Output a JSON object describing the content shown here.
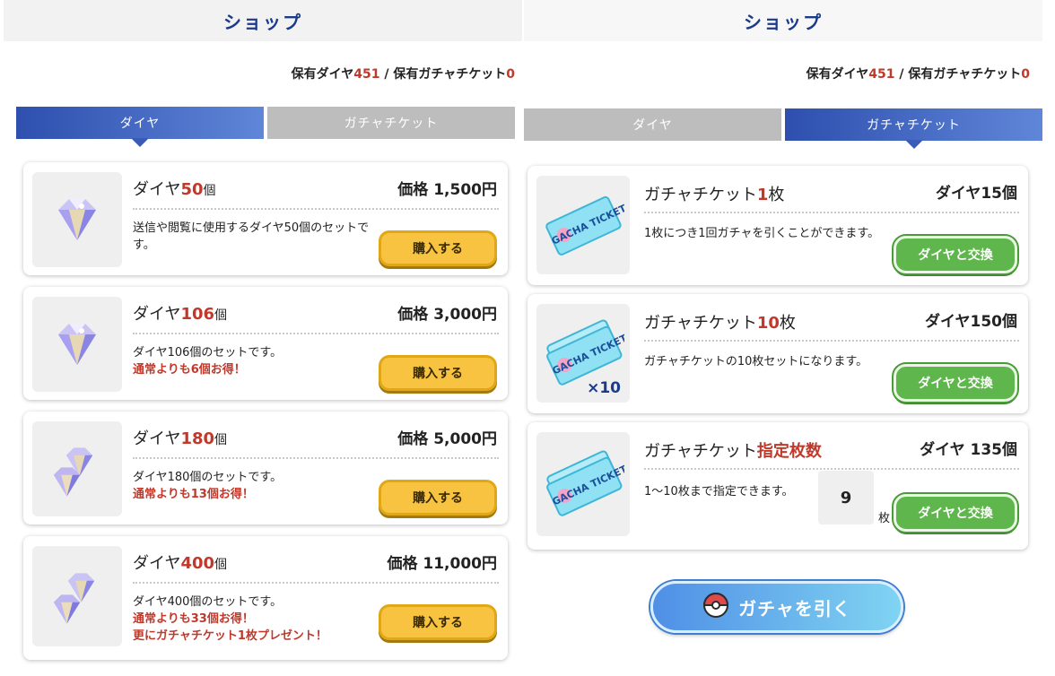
{
  "left": {
    "header": "ショップ",
    "balance": {
      "dia_label": "保有ダイヤ",
      "dia_value": "451",
      "sep": " / ",
      "ticket_label": "保有ガチャチケット",
      "ticket_value": "0"
    },
    "tabs": [
      {
        "label": "ダイヤ",
        "active": true
      },
      {
        "label": "ガチャチケット",
        "active": false
      }
    ],
    "items": [
      {
        "title_prefix": "ダイヤ",
        "amount": "50",
        "unit": "個",
        "price": "価格 1,500円",
        "desc": "送信や閲覧に使用するダイヤ50個のセットです。",
        "bonus": "",
        "bonus2": "",
        "button": "購入する"
      },
      {
        "title_prefix": "ダイヤ",
        "amount": "106",
        "unit": "個",
        "price": "価格 3,000円",
        "desc": "ダイヤ106個のセットです。",
        "bonus": "通常よりも6個お得！",
        "bonus2": "",
        "button": "購入する"
      },
      {
        "title_prefix": "ダイヤ",
        "amount": "180",
        "unit": "個",
        "price": "価格 5,000円",
        "desc": "ダイヤ180個のセットです。",
        "bonus": "通常よりも13個お得！",
        "bonus2": "",
        "button": "購入する"
      },
      {
        "title_prefix": "ダイヤ",
        "amount": "400",
        "unit": "個",
        "price": "価格 11,000円",
        "desc": "ダイヤ400個のセットです。",
        "bonus": "通常よりも33個お得！",
        "bonus2": "更にガチャチケット1枚プレゼント！",
        "button": "購入する"
      }
    ]
  },
  "right": {
    "header": "ショップ",
    "balance": {
      "dia_label": "保有ダイヤ",
      "dia_value": "451",
      "sep": " / ",
      "ticket_label": "保有ガチャチケット",
      "ticket_value": "0"
    },
    "tabs": [
      {
        "label": "ダイヤ",
        "active": false
      },
      {
        "label": "ガチャチケット",
        "active": true
      }
    ],
    "items": [
      {
        "title_prefix": "ガチャチケット",
        "amount": "1",
        "unit": "枚",
        "price": "ダイヤ15個",
        "desc": "1枚につき1回ガチャを引くことができます。",
        "button": "ダイヤと交換"
      },
      {
        "title_prefix": "ガチャチケット",
        "amount": "10",
        "unit": "枚",
        "price": "ダイヤ150個",
        "desc": "ガチャチケットの10枚セットになります。",
        "button": "ダイヤと交換",
        "badge": "×10"
      },
      {
        "title_prefix": "ガチャチケット",
        "amount": "指定枚数",
        "unit": "",
        "price": "ダイヤ 135個",
        "desc": "1〜10枚まで指定できます。",
        "button": "ダイヤと交換",
        "quantity": "9",
        "quantity_unit": "枚"
      }
    ],
    "ticket_text": "GACHA TICKET",
    "gacha_button": "ガチャを引く"
  },
  "colors": {
    "accent_blue": "#1b3a8c",
    "highlight_red": "#c0392b",
    "buy_yellow": "#f7c341",
    "exchange_green": "#5fb64c"
  }
}
